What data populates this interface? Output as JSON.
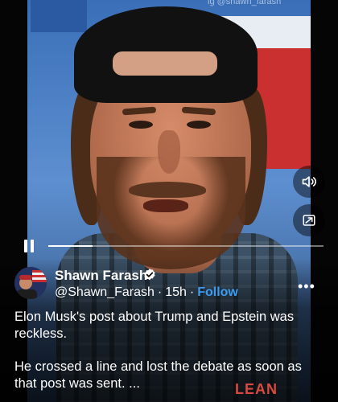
{
  "video": {
    "watermark": "ig @shawn_farash",
    "shirt_text": "LEAN",
    "progress_fraction": 0.16,
    "controls": {
      "volume_icon": "volume-icon",
      "pip_icon": "picture-in-picture-icon",
      "pause_icon": "pause-icon"
    }
  },
  "post": {
    "author_name": "Shawn Farash",
    "handle": "@Shawn_Farash",
    "separator": "·",
    "time": "15h",
    "follow_label": "Follow",
    "more_label": "•••",
    "paragraph_1": "Elon Musk's post about Trump and Epstein was reckless.",
    "paragraph_2": "He crossed a line and lost the debate as soon as that post was sent. ..."
  },
  "colors": {
    "accent": "#3b9cf0",
    "verified": "#ffffff",
    "background": "#000000"
  }
}
